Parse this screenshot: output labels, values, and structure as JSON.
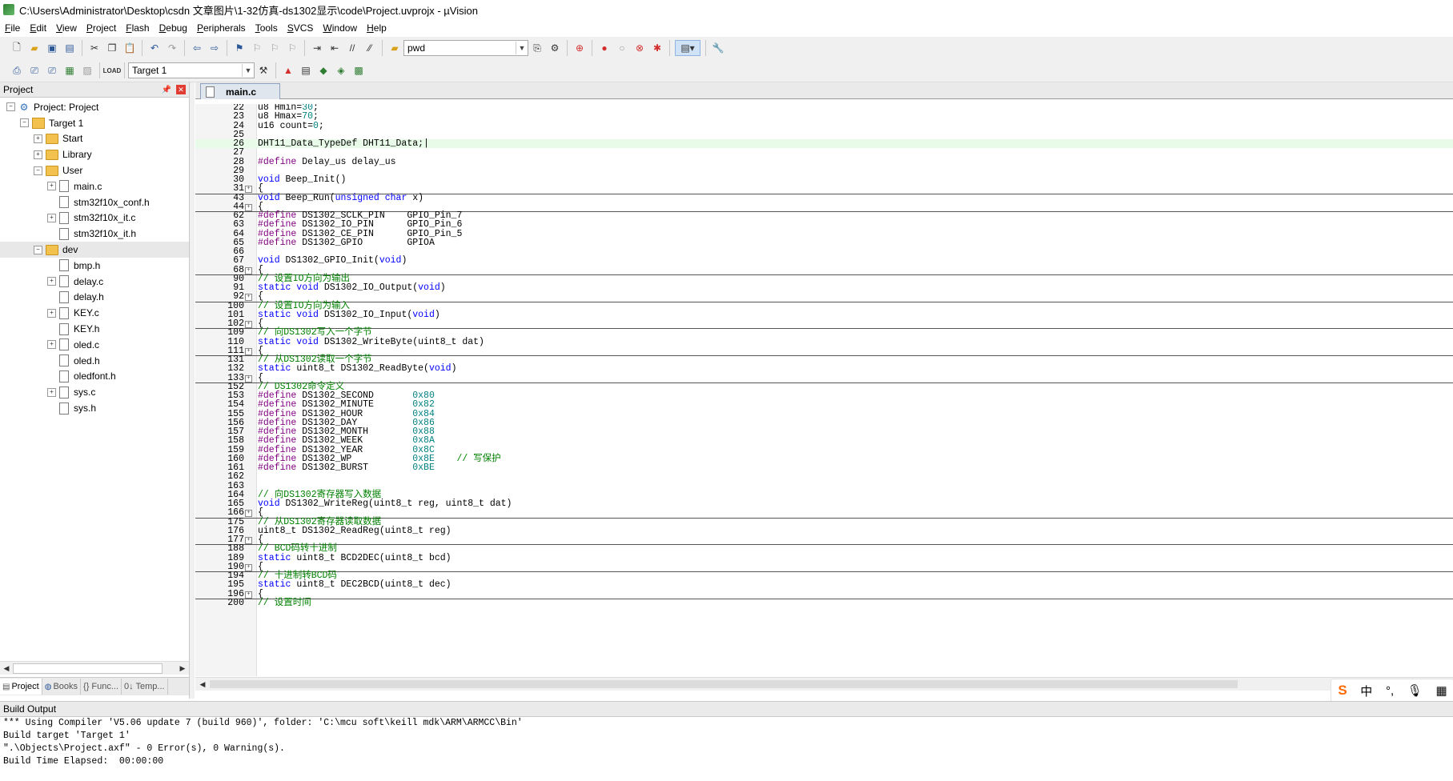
{
  "window": {
    "title": "C:\\Users\\Administrator\\Desktop\\csdn 文章图片\\1-32仿真-ds1302显示\\code\\Project.uvprojx - µVision"
  },
  "menu": [
    "File",
    "Edit",
    "View",
    "Project",
    "Flash",
    "Debug",
    "Peripherals",
    "Tools",
    "SVCS",
    "Window",
    "Help"
  ],
  "toolbar": {
    "find_combo_value": "pwd",
    "target_combo_value": "Target 1"
  },
  "project_panel": {
    "title": "Project",
    "tree": [
      {
        "label": "Project: Project",
        "level": 0,
        "kind": "project",
        "expander": "−"
      },
      {
        "label": "Target 1",
        "level": 1,
        "kind": "target",
        "expander": "−"
      },
      {
        "label": "Start",
        "level": 2,
        "kind": "folder",
        "expander": "+"
      },
      {
        "label": "Library",
        "level": 2,
        "kind": "folder",
        "expander": "+"
      },
      {
        "label": "User",
        "level": 2,
        "kind": "folder",
        "expander": "−"
      },
      {
        "label": "main.c",
        "level": 3,
        "kind": "file",
        "expander": "+"
      },
      {
        "label": "stm32f10x_conf.h",
        "level": 3,
        "kind": "file",
        "expander": ""
      },
      {
        "label": "stm32f10x_it.c",
        "level": 3,
        "kind": "file",
        "expander": "+"
      },
      {
        "label": "stm32f10x_it.h",
        "level": 3,
        "kind": "file",
        "expander": ""
      },
      {
        "label": "dev",
        "level": 2,
        "kind": "folder",
        "expander": "−",
        "selected": true
      },
      {
        "label": "bmp.h",
        "level": 3,
        "kind": "file",
        "expander": ""
      },
      {
        "label": "delay.c",
        "level": 3,
        "kind": "file",
        "expander": "+"
      },
      {
        "label": "delay.h",
        "level": 3,
        "kind": "file",
        "expander": ""
      },
      {
        "label": "KEY.c",
        "level": 3,
        "kind": "file",
        "expander": "+"
      },
      {
        "label": "KEY.h",
        "level": 3,
        "kind": "file",
        "expander": ""
      },
      {
        "label": "oled.c",
        "level": 3,
        "kind": "file",
        "expander": "+"
      },
      {
        "label": "oled.h",
        "level": 3,
        "kind": "file",
        "expander": ""
      },
      {
        "label": "oledfont.h",
        "level": 3,
        "kind": "file",
        "expander": ""
      },
      {
        "label": "sys.c",
        "level": 3,
        "kind": "file",
        "expander": "+"
      },
      {
        "label": "sys.h",
        "level": 3,
        "kind": "file",
        "expander": ""
      }
    ],
    "tabs": [
      {
        "label": "Project",
        "icon": "project-icon",
        "active": true
      },
      {
        "label": "Books",
        "icon": "books-icon"
      },
      {
        "label": "{} Func...",
        "icon": "functions-icon"
      },
      {
        "label": "0↓ Temp...",
        "icon": "templates-icon"
      }
    ]
  },
  "editor": {
    "tab_label": "main.c",
    "lines": [
      {
        "n": "22",
        "text": "u8 Hmin=30;",
        "spans": [
          [
            "u8 Hmin=",
            ""
          ],
          [
            "30",
            "nm"
          ],
          [
            ";",
            ""
          ]
        ]
      },
      {
        "n": "23",
        "spans": [
          [
            "u8 Hmax=",
            ""
          ],
          [
            "70",
            "nm"
          ],
          [
            ";",
            ""
          ]
        ]
      },
      {
        "n": "24",
        "spans": [
          [
            "u16 count=",
            ""
          ],
          [
            "0",
            "nm"
          ],
          [
            ";",
            ""
          ]
        ]
      },
      {
        "n": "25",
        "spans": []
      },
      {
        "n": "26",
        "spans": [
          [
            "DHT11_Data_TypeDef DHT11_Data;|",
            ""
          ]
        ],
        "current": true
      },
      {
        "n": "27",
        "spans": []
      },
      {
        "n": "28",
        "spans": [
          [
            "#define",
            "pp"
          ],
          [
            " Delay_us delay_us",
            ""
          ]
        ]
      },
      {
        "n": "29",
        "spans": []
      },
      {
        "n": "30",
        "spans": [
          [
            "void",
            "kw"
          ],
          [
            " Beep_Init()",
            ""
          ]
        ]
      },
      {
        "n": "31",
        "spans": [
          [
            "{",
            ""
          ]
        ],
        "fold": true
      },
      {
        "n": "43",
        "spans": [
          [
            "void",
            "kw"
          ],
          [
            " Beep_Run(",
            ""
          ],
          [
            "unsigned char",
            "kw"
          ],
          [
            " x)",
            ""
          ]
        ]
      },
      {
        "n": "44",
        "spans": [
          [
            "{",
            ""
          ]
        ],
        "fold": true
      },
      {
        "n": "62",
        "spans": [
          [
            "#define",
            "pp"
          ],
          [
            " DS1302_SCLK_PIN    GPIO_Pin_7",
            ""
          ]
        ]
      },
      {
        "n": "63",
        "spans": [
          [
            "#define",
            "pp"
          ],
          [
            " DS1302_IO_PIN      GPIO_Pin_6",
            ""
          ]
        ]
      },
      {
        "n": "64",
        "spans": [
          [
            "#define",
            "pp"
          ],
          [
            " DS1302_CE_PIN      GPIO_Pin_5",
            ""
          ]
        ]
      },
      {
        "n": "65",
        "spans": [
          [
            "#define",
            "pp"
          ],
          [
            " DS1302_GPIO        GPIOA",
            ""
          ]
        ]
      },
      {
        "n": "66",
        "spans": []
      },
      {
        "n": "67",
        "spans": [
          [
            "void",
            "kw"
          ],
          [
            " DS1302_GPIO_Init(",
            ""
          ],
          [
            "void",
            "kw"
          ],
          [
            ")",
            ""
          ]
        ]
      },
      {
        "n": "68",
        "spans": [
          [
            "{",
            ""
          ]
        ],
        "fold": true
      },
      {
        "n": "90",
        "spans": [
          [
            "// 设置IO方向为输出",
            "cm"
          ]
        ]
      },
      {
        "n": "91",
        "spans": [
          [
            "static void",
            "kw"
          ],
          [
            " DS1302_IO_Output(",
            ""
          ],
          [
            "void",
            "kw"
          ],
          [
            ")",
            ""
          ]
        ]
      },
      {
        "n": "92",
        "spans": [
          [
            "{",
            ""
          ]
        ],
        "fold": true
      },
      {
        "n": "100",
        "spans": [
          [
            "// 设置IO方向为输入",
            "cm"
          ]
        ]
      },
      {
        "n": "101",
        "spans": [
          [
            "static void",
            "kw"
          ],
          [
            " DS1302_IO_Input(",
            ""
          ],
          [
            "void",
            "kw"
          ],
          [
            ")",
            ""
          ]
        ]
      },
      {
        "n": "102",
        "spans": [
          [
            "{",
            ""
          ]
        ],
        "fold": true
      },
      {
        "n": "109",
        "spans": [
          [
            "// 向DS1302写入一个字节",
            "cm"
          ]
        ]
      },
      {
        "n": "110",
        "spans": [
          [
            "static void",
            "kw"
          ],
          [
            " DS1302_WriteByte(uint8_t dat)",
            ""
          ]
        ]
      },
      {
        "n": "111",
        "spans": [
          [
            "{",
            ""
          ]
        ],
        "fold": true
      },
      {
        "n": "131",
        "spans": [
          [
            "// 从DS1302读取一个字节",
            "cm"
          ]
        ]
      },
      {
        "n": "132",
        "spans": [
          [
            "static",
            "kw"
          ],
          [
            " uint8_t DS1302_ReadByte(",
            ""
          ],
          [
            "void",
            "kw"
          ],
          [
            ")",
            ""
          ]
        ]
      },
      {
        "n": "133",
        "spans": [
          [
            "{",
            ""
          ]
        ],
        "fold": true
      },
      {
        "n": "152",
        "spans": [
          [
            "// DS1302命令定义",
            "cm"
          ]
        ]
      },
      {
        "n": "153",
        "spans": [
          [
            "#define",
            "pp"
          ],
          [
            " DS1302_SECOND       ",
            ""
          ],
          [
            "0x80",
            "nm"
          ]
        ]
      },
      {
        "n": "154",
        "spans": [
          [
            "#define",
            "pp"
          ],
          [
            " DS1302_MINUTE       ",
            ""
          ],
          [
            "0x82",
            "nm"
          ]
        ]
      },
      {
        "n": "155",
        "spans": [
          [
            "#define",
            "pp"
          ],
          [
            " DS1302_HOUR         ",
            ""
          ],
          [
            "0x84",
            "nm"
          ]
        ]
      },
      {
        "n": "156",
        "spans": [
          [
            "#define",
            "pp"
          ],
          [
            " DS1302_DAY          ",
            ""
          ],
          [
            "0x86",
            "nm"
          ]
        ]
      },
      {
        "n": "157",
        "spans": [
          [
            "#define",
            "pp"
          ],
          [
            " DS1302_MONTH        ",
            ""
          ],
          [
            "0x88",
            "nm"
          ]
        ]
      },
      {
        "n": "158",
        "spans": [
          [
            "#define",
            "pp"
          ],
          [
            " DS1302_WEEK         ",
            ""
          ],
          [
            "0x8A",
            "nm"
          ]
        ]
      },
      {
        "n": "159",
        "spans": [
          [
            "#define",
            "pp"
          ],
          [
            " DS1302_YEAR         ",
            ""
          ],
          [
            "0x8C",
            "nm"
          ]
        ]
      },
      {
        "n": "160",
        "spans": [
          [
            "#define",
            "pp"
          ],
          [
            " DS1302_WP           ",
            ""
          ],
          [
            "0x8E",
            "nm"
          ],
          [
            "    ",
            ""
          ],
          [
            "// 写保护",
            "cm"
          ]
        ]
      },
      {
        "n": "161",
        "spans": [
          [
            "#define",
            "pp"
          ],
          [
            " DS1302_BURST        ",
            ""
          ],
          [
            "0xBE",
            "nm"
          ]
        ]
      },
      {
        "n": "162",
        "spans": []
      },
      {
        "n": "163",
        "spans": []
      },
      {
        "n": "164",
        "spans": [
          [
            "// 向DS1302寄存器写入数据",
            "cm"
          ]
        ]
      },
      {
        "n": "165",
        "spans": [
          [
            "void",
            "kw"
          ],
          [
            " DS1302_WriteReg(uint8_t reg, uint8_t dat)",
            ""
          ]
        ]
      },
      {
        "n": "166",
        "spans": [
          [
            "{",
            ""
          ]
        ],
        "fold": true
      },
      {
        "n": "175",
        "spans": [
          [
            "// 从DS1302寄存器读取数据",
            "cm"
          ]
        ]
      },
      {
        "n": "176",
        "spans": [
          [
            "uint8_t DS1302_ReadReg(uint8_t reg)",
            ""
          ]
        ]
      },
      {
        "n": "177",
        "spans": [
          [
            "{",
            ""
          ]
        ],
        "fold": true
      },
      {
        "n": "188",
        "spans": [
          [
            "// BCD码转十进制",
            "cm"
          ]
        ]
      },
      {
        "n": "189",
        "spans": [
          [
            "static",
            "kw"
          ],
          [
            " uint8_t BCD2DEC(uint8_t bcd)",
            ""
          ]
        ]
      },
      {
        "n": "190",
        "spans": [
          [
            "{",
            ""
          ]
        ],
        "fold": true
      },
      {
        "n": "194",
        "spans": [
          [
            "// 十进制转BCD码",
            "cm"
          ]
        ]
      },
      {
        "n": "195",
        "spans": [
          [
            "static",
            "kw"
          ],
          [
            " uint8_t DEC2BCD(uint8_t dec)",
            ""
          ]
        ]
      },
      {
        "n": "196",
        "spans": [
          [
            "{",
            ""
          ]
        ],
        "fold": true
      },
      {
        "n": "200",
        "spans": [
          [
            "// 设置时间",
            "cm"
          ]
        ]
      }
    ]
  },
  "ime": {
    "logo": "S",
    "mode": "中",
    "punct": "°,",
    "mic": "🎙",
    "keyboard": "▦"
  },
  "build_output": {
    "title": "Build Output",
    "lines": [
      "*** Using Compiler 'V5.06 update 7 (build 960)', folder: 'C:\\mcu soft\\keill mdk\\ARM\\ARMCC\\Bin'",
      "Build target 'Target 1'",
      "\".\\Objects\\Project.axf\" - 0 Error(s), 0 Warning(s).",
      "Build Time Elapsed:  00:00:00"
    ]
  }
}
